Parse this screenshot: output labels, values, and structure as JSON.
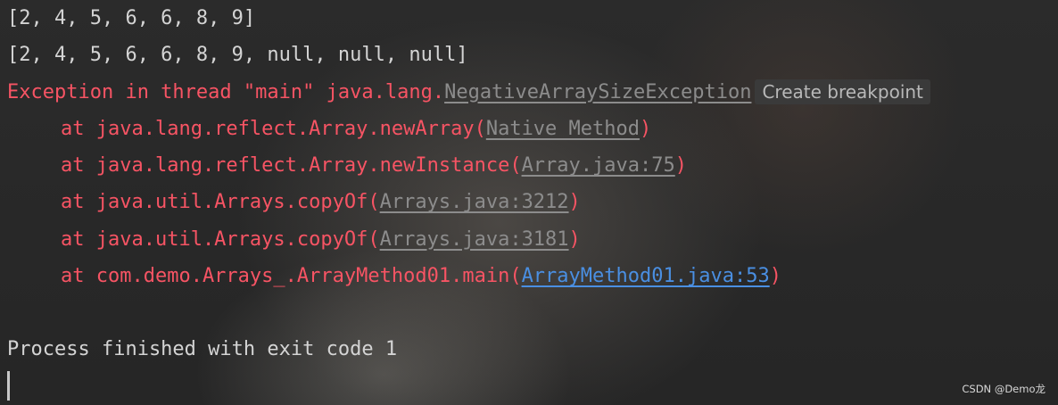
{
  "console": {
    "line1": "[2, 4, 5, 6, 6, 8, 9]",
    "line2": "[2, 4, 5, 6, 6, 8, 9, null, null, null]",
    "exception_prefix": "Exception in thread \"main\" java.lang.",
    "exception_class": "NegativeArraySizeException",
    "tooltip": "Create breakpoint",
    "stack": [
      {
        "method": "at java.lang.reflect.Array.newArray(",
        "location": "Native Method",
        "suffix": ")"
      },
      {
        "method": "at java.lang.reflect.Array.newInstance(",
        "location": "Array.java:75",
        "suffix": ")"
      },
      {
        "method": "at java.util.Arrays.copyOf(",
        "location": "Arrays.java:3212",
        "suffix": ")"
      },
      {
        "method": "at java.util.Arrays.copyOf(",
        "location": "Arrays.java:3181",
        "suffix": ")"
      },
      {
        "method": "at com.demo.Arrays_.ArrayMethod01.main(",
        "location": "ArrayMethod01.java:53",
        "suffix": ")"
      }
    ],
    "exit_message": "Process finished with exit code 1"
  },
  "watermark": "CSDN @Demo龙",
  "colors": {
    "background": "#2a2a2a",
    "stdout": "#d4d4d4",
    "error": "#f75464",
    "link_gray": "#8c8c8c",
    "link_blue": "#4a8fe2"
  }
}
